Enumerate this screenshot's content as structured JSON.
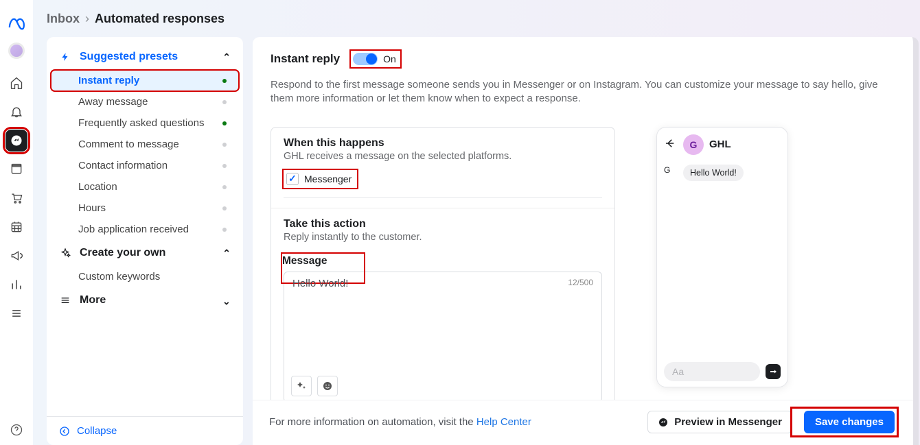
{
  "breadcrumb": {
    "inbox": "Inbox",
    "current": "Automated responses"
  },
  "sidebar": {
    "sections": {
      "presets": {
        "label": "Suggested presets"
      },
      "create": {
        "label": "Create your own"
      },
      "more": {
        "label": "More"
      }
    },
    "presets": [
      {
        "label": "Instant reply",
        "active": true
      },
      {
        "label": "Away message",
        "active": false
      },
      {
        "label": "Frequently asked questions",
        "active": true
      },
      {
        "label": "Comment to message",
        "active": false
      },
      {
        "label": "Contact information",
        "active": false
      },
      {
        "label": "Location",
        "active": false
      },
      {
        "label": "Hours",
        "active": false
      },
      {
        "label": "Job application received",
        "active": false
      }
    ],
    "create_items": [
      {
        "label": "Custom keywords"
      }
    ],
    "collapse": "Collapse"
  },
  "main": {
    "title": "Instant reply",
    "toggle_label": "On",
    "desc": "Respond to the first message someone sends you in Messenger or on Instagram. You can customize your message to say hello, give them more information or let them know when to expect a response.",
    "when": {
      "title": "When this happens",
      "sub": "GHL receives a message on the selected platforms.",
      "checkbox": "Messenger"
    },
    "action": {
      "title": "Take this action",
      "sub": "Reply instantly to the customer.",
      "message_label": "Message",
      "message_value": "Hello World!",
      "counter": "12/500"
    },
    "preview": {
      "account": "GHL",
      "avatar_letter": "G",
      "bubble": "Hello World!",
      "input_placeholder": "Aa"
    },
    "footer": {
      "text_prefix": "For more information on automation, visit the ",
      "link": "Help Center",
      "preview_btn": "Preview in Messenger",
      "save_btn": "Save changes"
    }
  }
}
